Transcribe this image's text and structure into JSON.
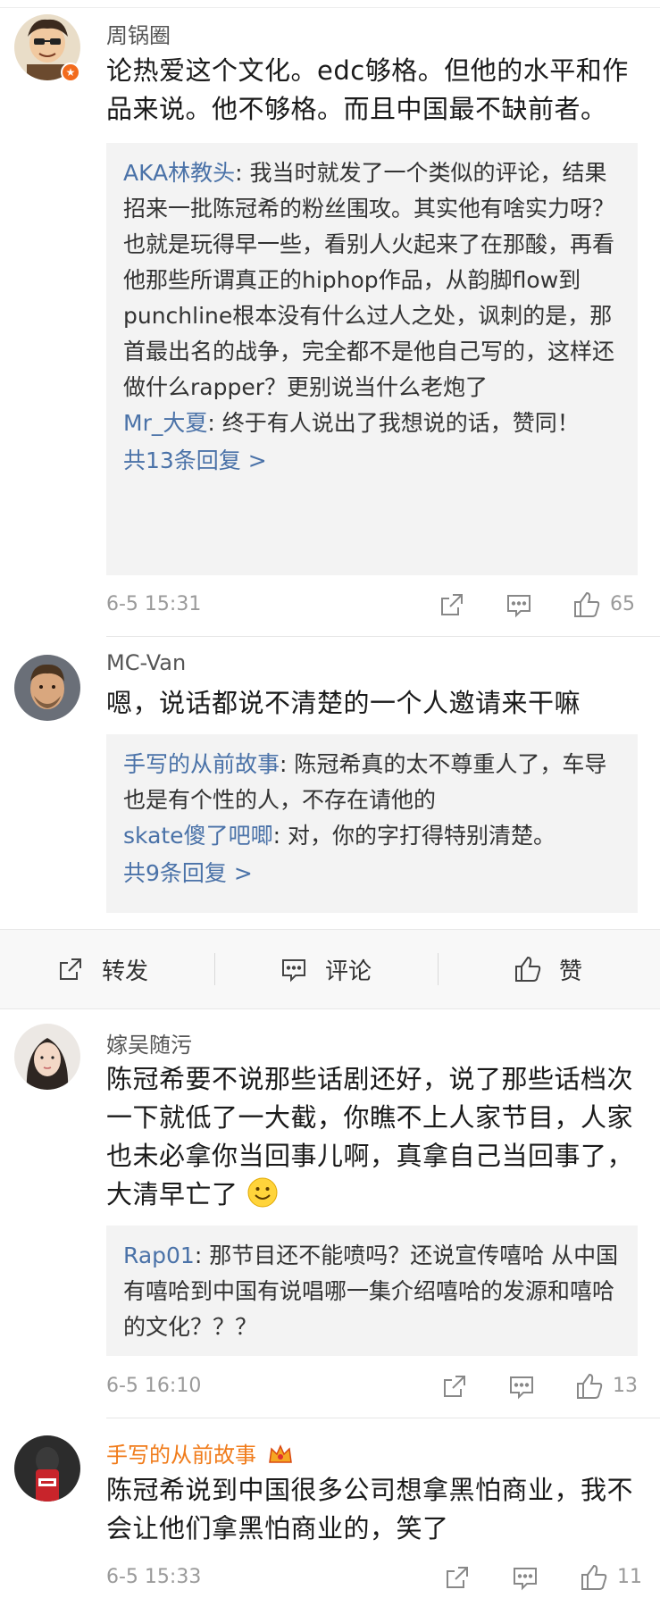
{
  "comments": [
    {
      "username": "周锅圈",
      "text": "论热爱这个文化。edc够格。但他的水平和作品来说。他不够格。而且中国最不缺前者。",
      "replies": [
        {
          "name": "AKA林教头",
          "text": ": 我当时就发了一个类似的评论，结果招来一批陈冠希的粉丝围攻。其实他有啥实力呀？也就是玩得早一些，看别人火起来了在那酸，再看他那些所谓真正的hiphop作品，从韵脚flow到punchline根本没有什么过人之处，讽刺的是，那首最出名的战争，完全都不是他自己写的，这样还做什么rapper？更别说当什么老炮了"
        },
        {
          "name": "Mr_大夏",
          "text": ": 终于有人说出了我想说的话，赞同！"
        }
      ],
      "more_replies": "共13条回复 >",
      "time": "6-5 15:31",
      "likes": "65"
    },
    {
      "username": "MC-Van",
      "text": "嗯，说话都说不清楚的一个人邀请来干嘛",
      "replies": [
        {
          "name": "手写的从前故事",
          "text": ": 陈冠希真的太不尊重人了，车导也是有个性的人，不存在请他的"
        },
        {
          "name": "skate傻了吧唧",
          "text": ": 对，你的字打得特别清楚。"
        }
      ],
      "more_replies": "共9条回复 >"
    },
    {
      "username": "嫁吴随污",
      "text": "陈冠希要不说那些话剧还好，说了那些话档次一下就低了一大截，你瞧不上人家节目，人家也未必拿你当回事儿啊，真拿自己当回事了，大清早亡了",
      "replies": [
        {
          "name": "Rap01",
          "text": ": 那节目还不能喷吗？还说宣传嘻哈 从中国有嘻哈到中国有说唱哪一集介绍嘻哈的发源和嘻哈的文化？？？"
        }
      ],
      "time": "6-5 16:10",
      "likes": "13"
    },
    {
      "username": "手写的从前故事",
      "text": "陈冠希说到中国很多公司想拿黑怕商业，我不会让他们拿黑怕商业的，笑了",
      "time": "6-5 15:33",
      "likes": "11"
    }
  ],
  "actionbar": {
    "repost": "转发",
    "comment": "评论",
    "like": "赞"
  },
  "icons": {
    "share": "share-icon",
    "reply": "comment-icon",
    "like": "thumbs-up-icon",
    "smile": "smile-emoji-icon",
    "verified": "verified-badge-icon"
  },
  "colors": {
    "link_blue": "#4a72a8",
    "name_orange": "#f07b1a",
    "meta_gray": "#9a9a9a"
  }
}
